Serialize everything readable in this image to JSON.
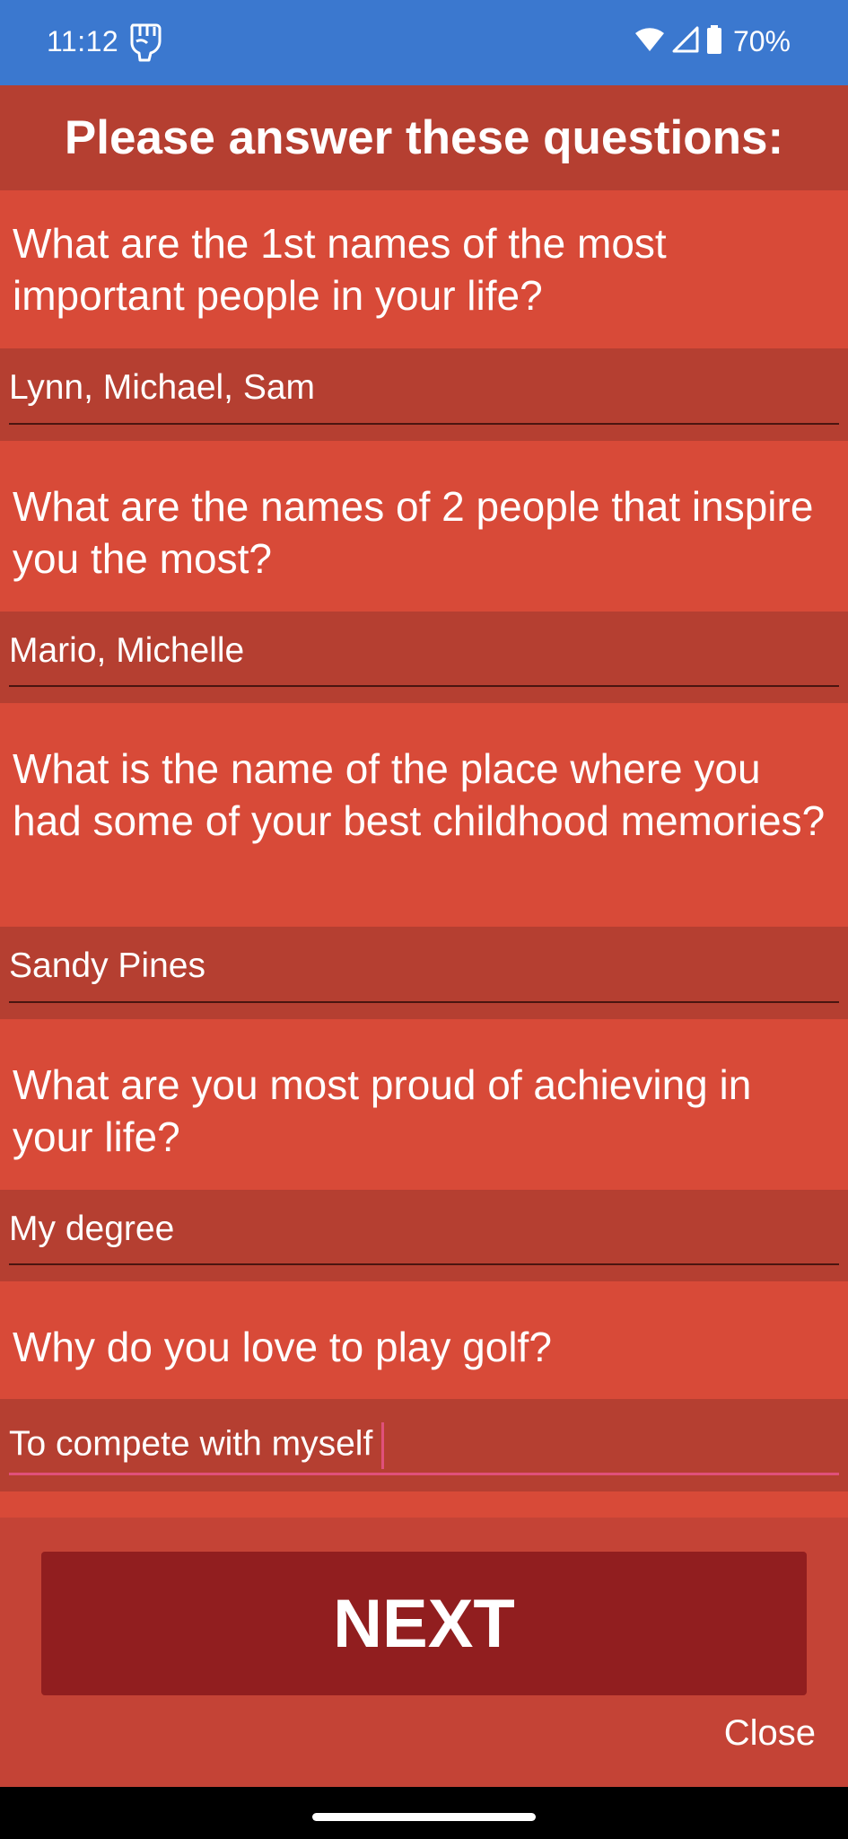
{
  "status_bar": {
    "time": "11:12",
    "app_icon": "fist-icon",
    "wifi_icon": "wifi-icon",
    "signal_icon": "cell-signal-icon",
    "battery_icon": "battery-icon",
    "battery_percent": "70%"
  },
  "header": {
    "title": "Please answer these questions:"
  },
  "questions": [
    {
      "question": "What are the 1st names of the most important people in your life?",
      "answer": "Lynn, Michael, Sam"
    },
    {
      "question": "What are the names of 2 people that inspire you the most?",
      "answer": "Mario, Michelle"
    },
    {
      "question": "What is the name of the place where you had some of your best childhood memories?",
      "answer": "Sandy Pines"
    },
    {
      "question": "What are you most proud of achieving in your life?",
      "answer": "My degree"
    },
    {
      "question": "Why do you love to play golf?",
      "answer": "To compete with myself"
    }
  ],
  "actions": {
    "next_label": "NEXT",
    "close_label": "Close"
  },
  "colors": {
    "status_bar": "#3b78cf",
    "question_bg": "#d84a38",
    "answer_bg": "#b53f31",
    "button_bg": "#911e1f",
    "focus_accent": "#e0507a"
  }
}
